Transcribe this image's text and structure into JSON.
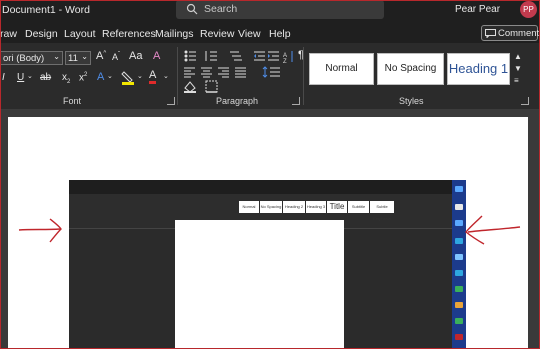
{
  "window": {
    "title": "Document1 - Word",
    "user_name": "Pear Pear",
    "user_initials": "PP"
  },
  "search": {
    "placeholder": "Search"
  },
  "menu": {
    "items": [
      "raw",
      "Design",
      "Layout",
      "References",
      "Mailings",
      "Review",
      "View",
      "Help"
    ],
    "comments_label": "Comments"
  },
  "ribbon": {
    "font": {
      "name": "ori (Body)",
      "size": "11",
      "group_label": "Font"
    },
    "paragraph": {
      "group_label": "Paragraph"
    },
    "styles": {
      "group_label": "Styles",
      "items": [
        "Normal",
        "No Spacing",
        "Heading 1"
      ]
    }
  },
  "inner_screenshot": {
    "style_items": [
      "Normal",
      "No Spacing",
      "Heading 2",
      "Heading 3",
      "Title",
      "Subtitle",
      "Subtle Emphasis"
    ]
  },
  "colors": {
    "accent_red": "#c0262c",
    "text_highlight_yellow": "#f2e600",
    "font_color_red": "#e02b2b",
    "inner_taskbar": "#1c3b8c",
    "avatar": "#c23b4e"
  }
}
